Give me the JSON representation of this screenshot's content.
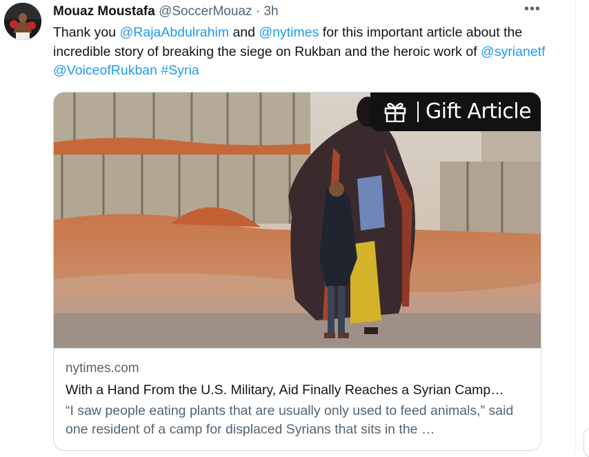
{
  "tweet": {
    "author_name": "Mouaz Moustafa",
    "handle": "@SoccerMouaz",
    "separator": "·",
    "time": "3h",
    "more_label": "•••",
    "text_parts": {
      "p1": "Thank you ",
      "m1": "@RajaAbdulrahim",
      "p2": " and ",
      "m2": "@nytimes",
      "p3": " for this important article about the incredible story of breaking the siege on Rukban and the heroic work of ",
      "m3": "@syrianetf",
      "p4": " ",
      "m4": "@VoiceofRukban",
      "p5": " ",
      "m5": "#Syria"
    }
  },
  "card": {
    "gift_label": "Gift Article",
    "domain": "nytimes.com",
    "title": "With a Hand From the U.S. Military, Aid Finally Reaches a Syrian Camp…",
    "description": "“I saw people eating plants that are usually only used to feed animals,” said one resident of a camp for displaced Syrians that sits in the …"
  },
  "colors": {
    "link": "#1d9bf0",
    "secondary_text": "#536471",
    "border": "#cfd9de"
  },
  "icons": {
    "gift": "gift-icon",
    "more": "more-dots-icon"
  }
}
